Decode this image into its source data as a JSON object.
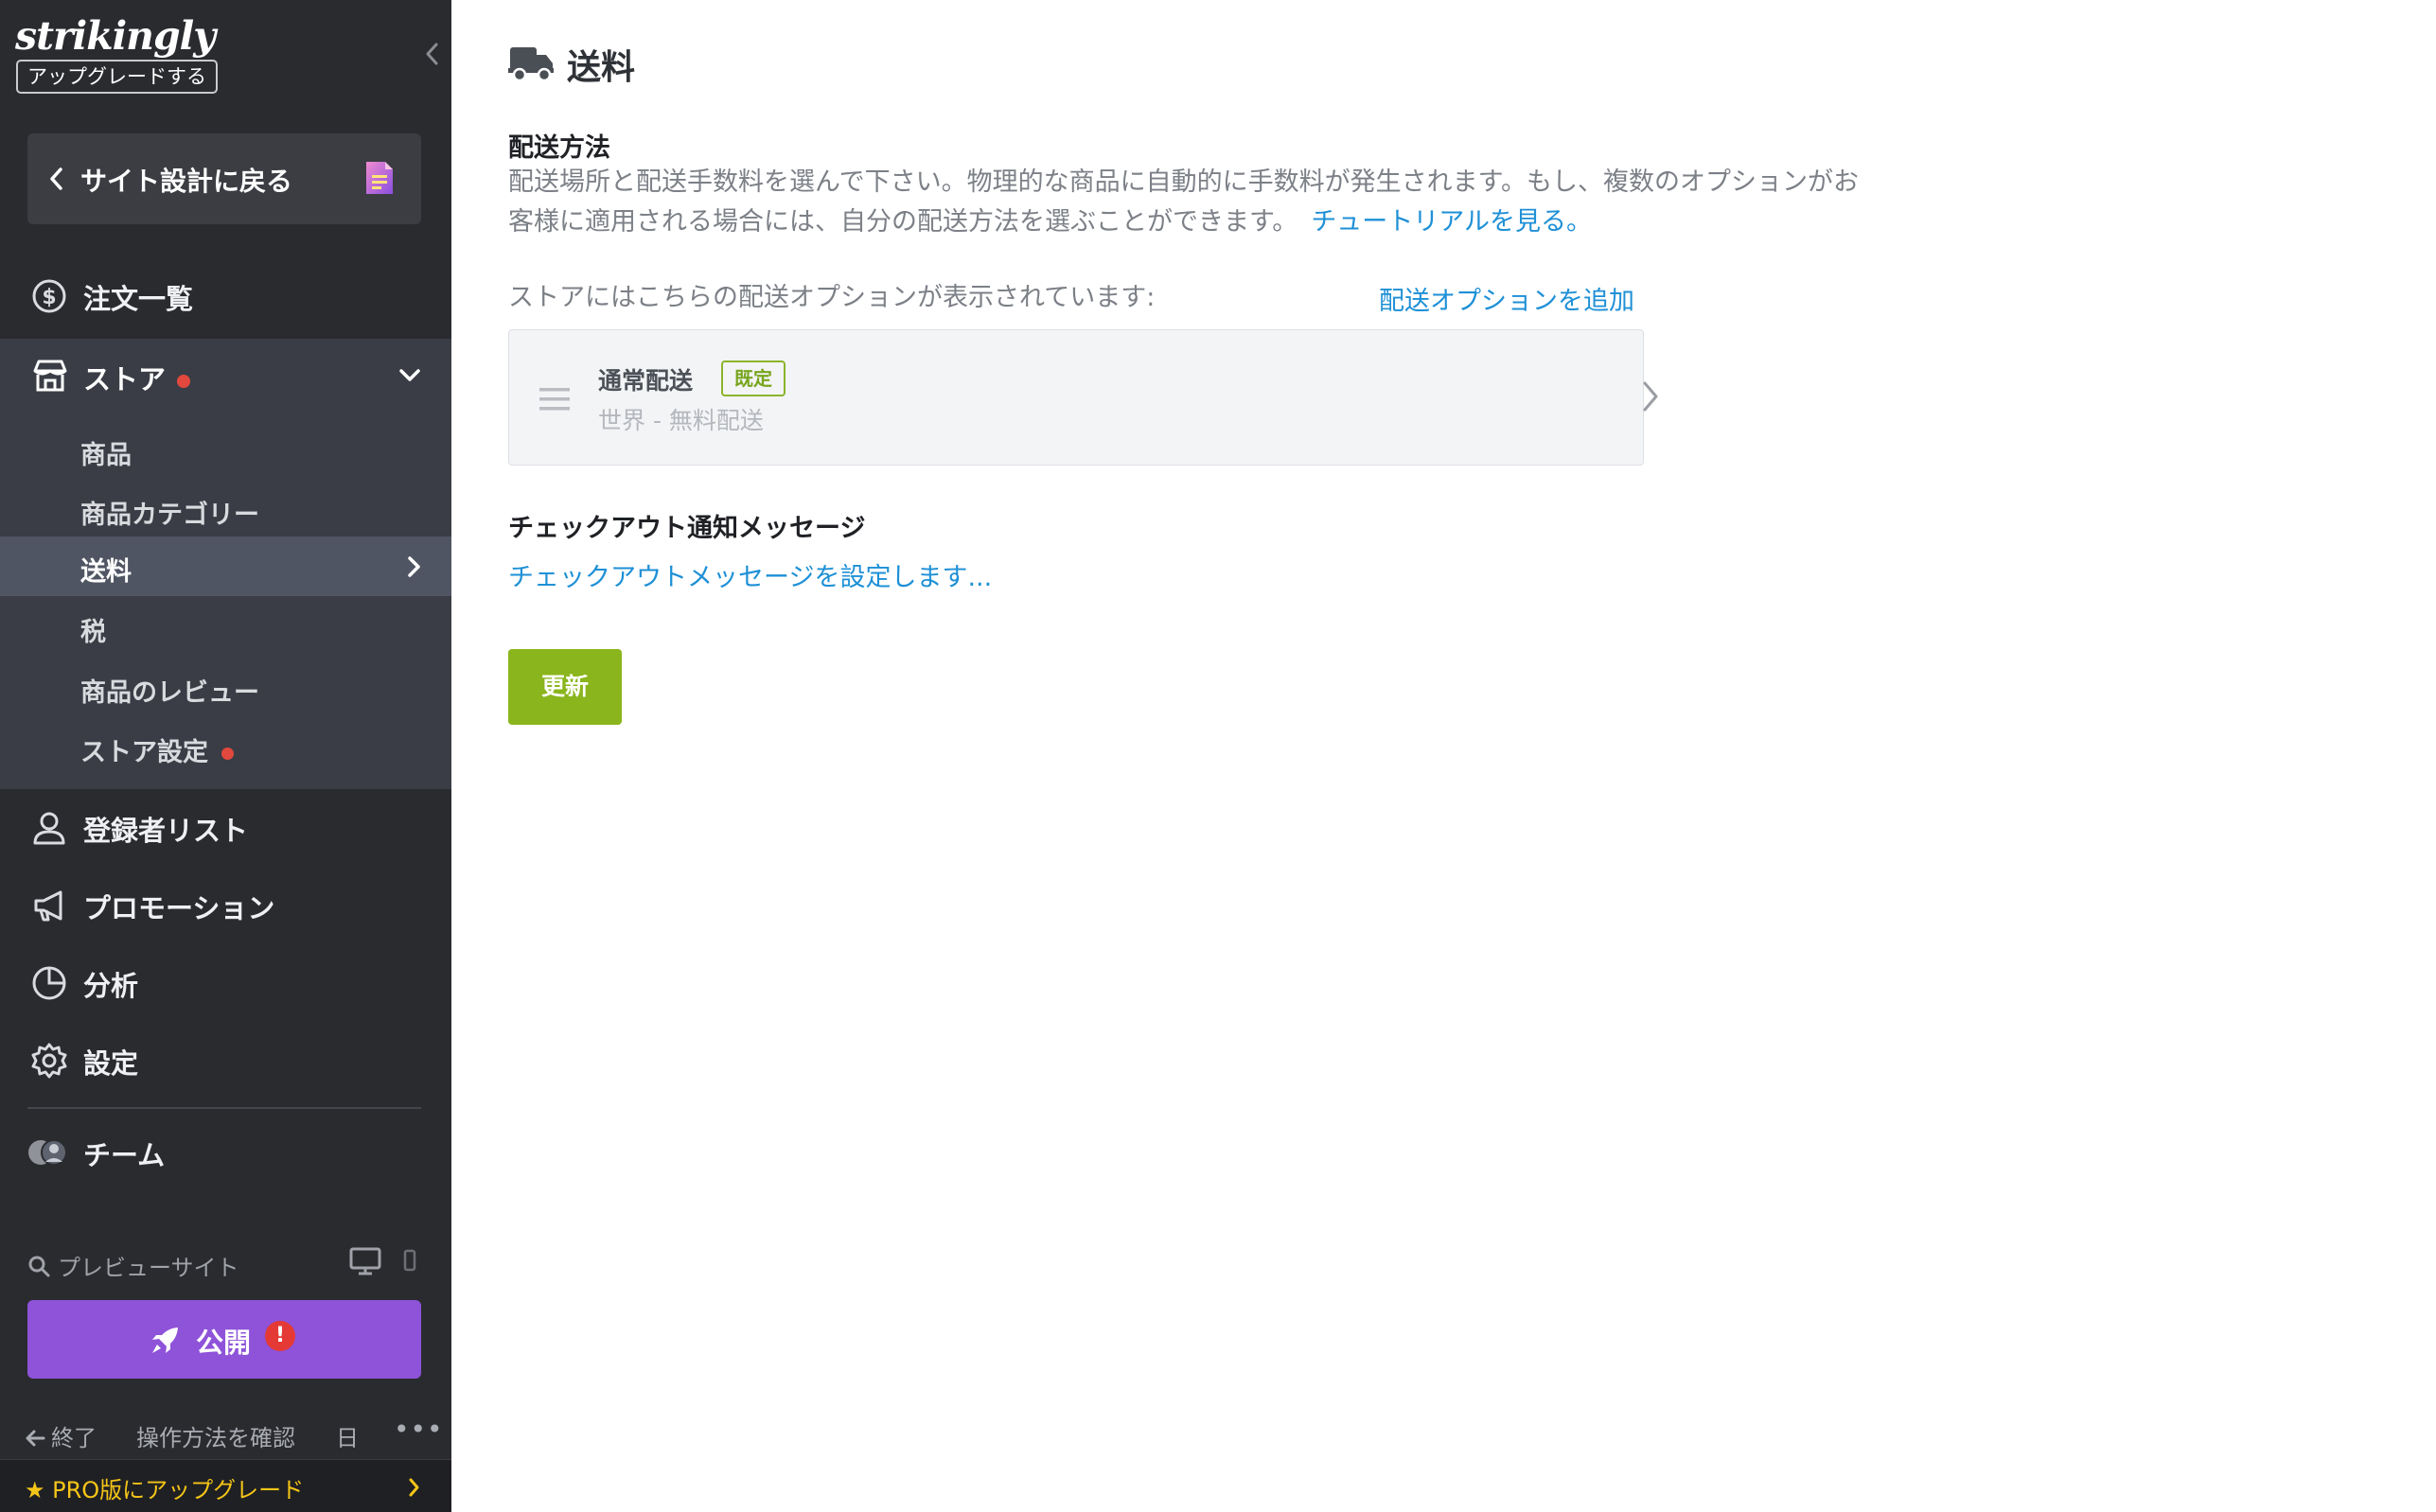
{
  "sidebar": {
    "logo": "strikingly",
    "upgrade_chip": "アップグレードする",
    "back_button": "サイト設計に戻る",
    "nav": {
      "orders": "注文一覧",
      "store": "ストア",
      "subscribers": "登録者リスト",
      "promotions": "プロモーション",
      "analytics": "分析",
      "settings": "設定",
      "team": "チーム"
    },
    "store_items": [
      {
        "label": "商品"
      },
      {
        "label": "商品カテゴリー"
      },
      {
        "label": "送料"
      },
      {
        "label": "税"
      },
      {
        "label": "商品のレビュー"
      },
      {
        "label": "ストア設定"
      }
    ],
    "preview_label": "プレビューサイト",
    "publish_label": "公開",
    "publish_alert": "!",
    "footer": {
      "exit": "終了",
      "howto": "操作方法を確認",
      "lang": "日",
      "more": "•••"
    },
    "pro_upgrade": "★ PRO版にアップグレード"
  },
  "main": {
    "title": "送料",
    "shipping_method_heading": "配送方法",
    "description": "配送場所と配送手数料を選んで下さい。物理的な商品に自動的に手数料が発生されます。もし、複数のオプションがお客様に適用される場合には、自分の配送方法を選ぶことができます。",
    "tutorial_link": "チュートリアルを見る。",
    "options_caption": "ストアにはこちらの配送オプションが表示されています:",
    "add_option": "配送オプションを追加",
    "shipping_option": {
      "name": "通常配送",
      "badge": "既定",
      "detail": "世界 - 無料配送"
    },
    "checkout_heading": "チェックアウト通知メッセージ",
    "checkout_link": "チェックアウトメッセージを設定します...",
    "update_button": "更新"
  },
  "colors": {
    "sidebar_bg": "#2a2b2f",
    "store_section_bg": "#3a3d45",
    "active_item_bg": "#505563",
    "publish_purple": "#8e53d9",
    "update_green": "#8ab51c",
    "link_blue": "#1e90d6",
    "alert_red": "#e2483d",
    "pro_gold": "#f5c518"
  }
}
